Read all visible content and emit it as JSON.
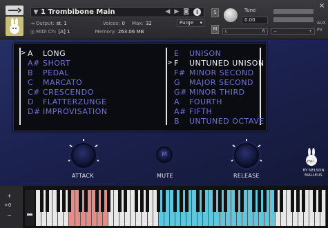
{
  "header": {
    "instrument_name": "1 Trombibone Main",
    "output_label": "Output:",
    "output_value": "st. 1",
    "voices_label": "Voices:",
    "voices_value": "0",
    "max_label": "Max:",
    "max_value": "32",
    "purge_label": "Purge",
    "midi_label": "MIDI Ch:",
    "midi_value": "[A] 1",
    "memory_label": "Memory:",
    "memory_value": "263.06 MB",
    "solo_label": "S",
    "mute_label": "M",
    "tune_label": "Tune",
    "tune_value": "0.00",
    "pan_left": "L",
    "pan_right": "R",
    "aux_label": "AUX",
    "pv_label": "PV"
  },
  "articulations": {
    "left": [
      {
        "key": "A",
        "name": "LONG",
        "selected": true
      },
      {
        "key": "A#",
        "name": "SHORT",
        "selected": false
      },
      {
        "key": "B",
        "name": "PEDAL",
        "selected": false
      },
      {
        "key": "C",
        "name": "MARCATO",
        "selected": false
      },
      {
        "key": "C#",
        "name": "CRESCENDO",
        "selected": false
      },
      {
        "key": "D",
        "name": "FLATTERZUNGE",
        "selected": false
      },
      {
        "key": "D#",
        "name": "IMPROVISATION",
        "selected": false
      }
    ],
    "right": [
      {
        "key": "E",
        "name": "UNISON",
        "selected": false
      },
      {
        "key": "F",
        "name": "UNTUNED UNISON",
        "selected": true
      },
      {
        "key": "F#",
        "name": "MINOR SECOND",
        "selected": false
      },
      {
        "key": "G",
        "name": "MAJOR SECOND",
        "selected": false
      },
      {
        "key": "G#",
        "name": "MINOR THIRD",
        "selected": false
      },
      {
        "key": "A",
        "name": "FOURTH",
        "selected": false
      },
      {
        "key": "A#",
        "name": "FIFTH",
        "selected": false
      },
      {
        "key": "B",
        "name": "UNTUNED OCTAVE",
        "selected": false
      }
    ]
  },
  "controls": {
    "attack_label": "ATTACK",
    "mute_label": "MUTE",
    "mute_button": "M",
    "release_label": "RELEASE"
  },
  "branding": {
    "line1": "BY NELSON",
    "line2": "MALLEUS",
    "logo_text": "msl"
  },
  "keyboard": {
    "octave_value": "+0",
    "colors": {
      "keyswitch": "#e98a86",
      "playable": "#5fc7dd",
      "normal": "#e8e8e8"
    }
  },
  "colors": {
    "accent": "#6f74d8",
    "selected_text": "#f2f2f2",
    "panel_bg": "#1c2250"
  }
}
